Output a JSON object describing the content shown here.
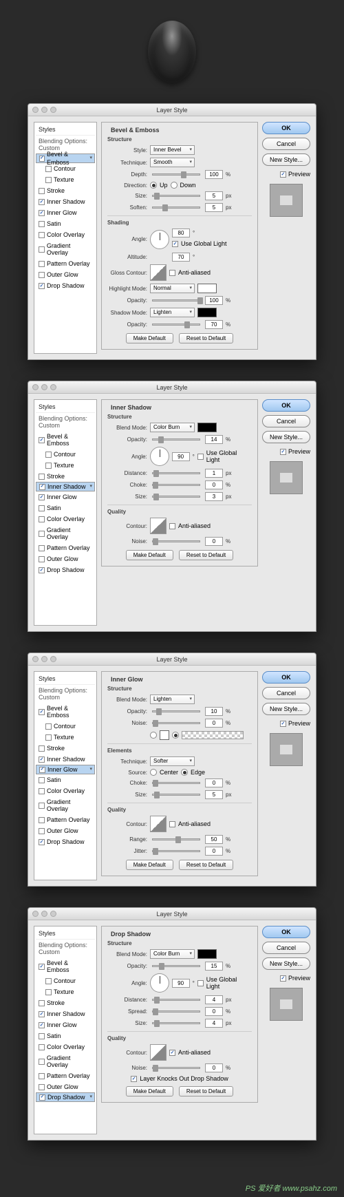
{
  "global": {
    "title": "Layer Style",
    "sidebar_header": "Styles",
    "sidebar_sub": "Blending Options: Custom",
    "ok": "OK",
    "cancel": "Cancel",
    "newstyle": "New Style...",
    "preview": "Preview",
    "make_default": "Make Default",
    "reset_default": "Reset to Default",
    "anti": "Anti-aliased",
    "ugl": "Use Global Light"
  },
  "sidebar_items": [
    {
      "label": "Bevel & Emboss",
      "on": true
    },
    {
      "label": "Contour",
      "on": false,
      "ind": true
    },
    {
      "label": "Texture",
      "on": false,
      "ind": true
    },
    {
      "label": "Stroke",
      "on": false
    },
    {
      "label": "Inner Shadow",
      "on": true
    },
    {
      "label": "Inner Glow",
      "on": true
    },
    {
      "label": "Satin",
      "on": false
    },
    {
      "label": "Color Overlay",
      "on": false
    },
    {
      "label": "Gradient Overlay",
      "on": false
    },
    {
      "label": "Pattern Overlay",
      "on": false
    },
    {
      "label": "Outer Glow",
      "on": false
    },
    {
      "label": "Drop Shadow",
      "on": true
    }
  ],
  "bevel": {
    "title": "Bevel & Emboss",
    "structure": "Structure",
    "shading": "Shading",
    "style_l": "Style:",
    "style_v": "Inner Bevel",
    "tech_l": "Technique:",
    "tech_v": "Smooth",
    "depth_l": "Depth:",
    "depth_v": "100",
    "dir_l": "Direction:",
    "up": "Up",
    "down": "Down",
    "size_l": "Size:",
    "size_v": "5",
    "soften_l": "Soften:",
    "soften_v": "5",
    "angle_l": "Angle:",
    "angle_v": "80",
    "alt_l": "Altitude:",
    "alt_v": "70",
    "gc_l": "Gloss Contour:",
    "hm_l": "Highlight Mode:",
    "hm_v": "Normal",
    "hm_o": "100",
    "sm_l": "Shadow Mode:",
    "sm_v": "Lighten",
    "sm_o": "70",
    "op_l": "Opacity:"
  },
  "ishadow": {
    "title": "Inner Shadow",
    "structure": "Structure",
    "quality": "Quality",
    "bm_l": "Blend Mode:",
    "bm_v": "Color Burn",
    "op_l": "Opacity:",
    "op_v": "14",
    "ang_l": "Angle:",
    "ang_v": "90",
    "dist_l": "Distance:",
    "dist_v": "1",
    "choke_l": "Choke:",
    "choke_v": "0",
    "size_l": "Size:",
    "size_v": "3",
    "cont_l": "Contour:",
    "noise_l": "Noise:",
    "noise_v": "0"
  },
  "iglow": {
    "title": "Inner Glow",
    "structure": "Structure",
    "elements": "Elements",
    "quality": "Quality",
    "bm_l": "Blend Mode:",
    "bm_v": "Lighten",
    "op_l": "Opacity:",
    "op_v": "10",
    "noise_l": "Noise:",
    "noise_v": "0",
    "tech_l": "Technique:",
    "tech_v": "Softer",
    "src_l": "Source:",
    "center": "Center",
    "edge": "Edge",
    "choke_l": "Choke:",
    "choke_v": "0",
    "size_l": "Size:",
    "size_v": "5",
    "cont_l": "Contour:",
    "range_l": "Range:",
    "range_v": "50",
    "jitter_l": "Jitter:",
    "jitter_v": "0"
  },
  "dshadow": {
    "title": "Drop Shadow",
    "structure": "Structure",
    "quality": "Quality",
    "bm_l": "Blend Mode:",
    "bm_v": "Color Burn",
    "op_l": "Opacity:",
    "op_v": "15",
    "ang_l": "Angle:",
    "ang_v": "90",
    "dist_l": "Distance:",
    "dist_v": "4",
    "spread_l": "Spread:",
    "spread_v": "0",
    "size_l": "Size:",
    "size_v": "4",
    "cont_l": "Contour:",
    "noise_l": "Noise:",
    "noise_v": "0",
    "knock": "Layer Knocks Out Drop Shadow"
  },
  "watermark": "PS 爱好者 www.psahz.com"
}
